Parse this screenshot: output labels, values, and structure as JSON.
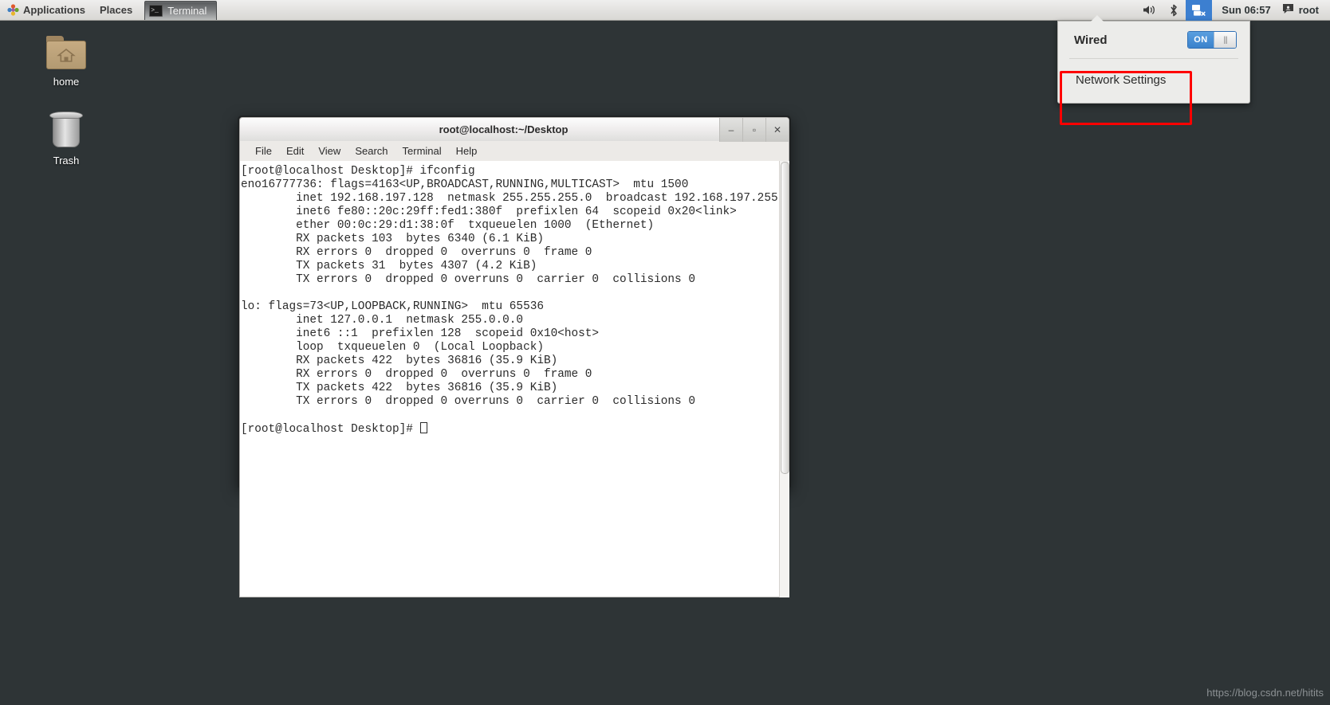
{
  "panel": {
    "applications_label": "Applications",
    "places_label": "Places",
    "window_button_label": "Terminal",
    "window_button_icon": "terminal-icon",
    "applications_icon": "applications-starburst-icon",
    "tray": {
      "volume_icon": "volume-icon",
      "bluetooth_icon": "bluetooth-icon",
      "network_icon": "network-wired-disconnected-icon",
      "clock": "Sun 06:57",
      "user_icon": "user-icon",
      "user_name": "root"
    }
  },
  "network_menu": {
    "connection_label": "Wired",
    "toggle_state": "ON",
    "toggle_knob_icon": "switch-knob-grip",
    "settings_label": "Network Settings",
    "highlight_color": "#fe0000",
    "accent_color": "#3b82cc"
  },
  "desktop": {
    "icons": [
      {
        "label": "home",
        "icon": "folder-home-icon"
      },
      {
        "label": "Trash",
        "icon": "trash-can-icon"
      }
    ]
  },
  "terminal": {
    "title": "root@localhost:~/Desktop",
    "window_buttons": {
      "minimize": "–",
      "maximize": "▫",
      "close": "✕"
    },
    "menu": [
      "File",
      "Edit",
      "View",
      "Search",
      "Terminal",
      "Help"
    ],
    "lines": [
      "[root@localhost Desktop]# ifconfig",
      "eno16777736: flags=4163<UP,BROADCAST,RUNNING,MULTICAST>  mtu 1500",
      "        inet 192.168.197.128  netmask 255.255.255.0  broadcast 192.168.197.255",
      "        inet6 fe80::20c:29ff:fed1:380f  prefixlen 64  scopeid 0x20<link>",
      "        ether 00:0c:29:d1:38:0f  txqueuelen 1000  (Ethernet)",
      "        RX packets 103  bytes 6340 (6.1 KiB)",
      "        RX errors 0  dropped 0  overruns 0  frame 0",
      "        TX packets 31  bytes 4307 (4.2 KiB)",
      "        TX errors 0  dropped 0 overruns 0  carrier 0  collisions 0",
      "",
      "lo: flags=73<UP,LOOPBACK,RUNNING>  mtu 65536",
      "        inet 127.0.0.1  netmask 255.0.0.0",
      "        inet6 ::1  prefixlen 128  scopeid 0x10<host>",
      "        loop  txqueuelen 0  (Local Loopback)",
      "        RX packets 422  bytes 36816 (35.9 KiB)",
      "        RX errors 0  dropped 0  overruns 0  frame 0",
      "        TX packets 422  bytes 36816 (35.9 KiB)",
      "        TX errors 0  dropped 0 overruns 0  carrier 0  collisions 0",
      ""
    ],
    "prompt": "[root@localhost Desktop]# "
  },
  "watermark": "https://blog.csdn.net/hitits"
}
